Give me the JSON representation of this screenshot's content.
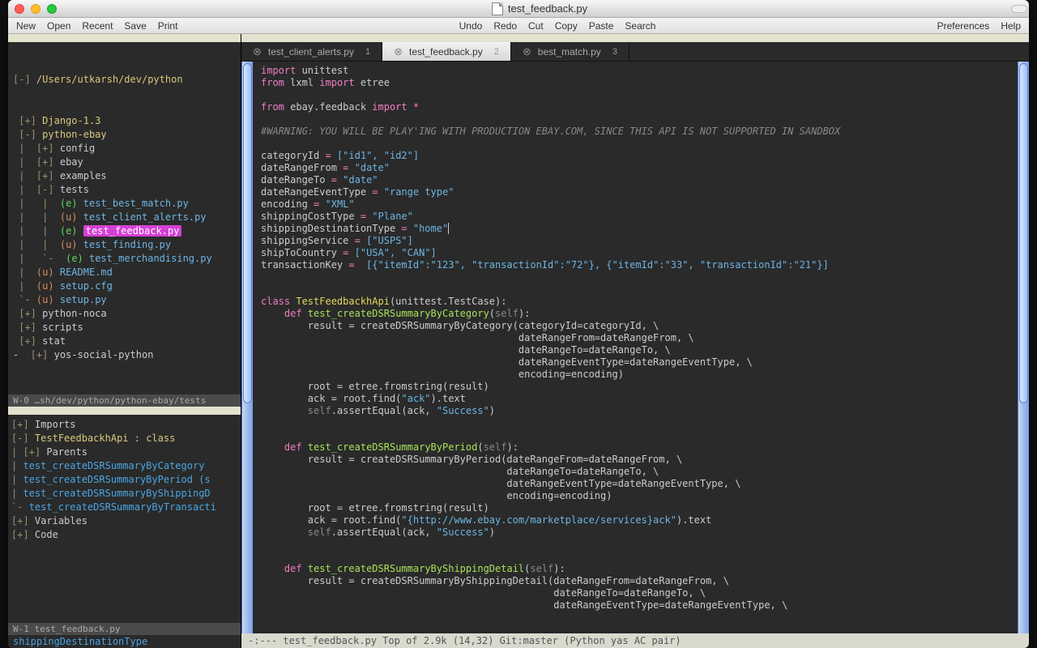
{
  "window": {
    "title": "test_feedback.py"
  },
  "menubar": {
    "left": [
      "New",
      "Open",
      "Recent",
      "Save",
      "Print"
    ],
    "center": [
      "Undo",
      "Redo",
      "Cut",
      "Copy",
      "Paste",
      "Search"
    ],
    "right": [
      "Preferences",
      "Help"
    ]
  },
  "sidebar": {
    "root": "/Users/utkarsh/dev/python",
    "tree": [
      {
        "indent": 0,
        "exp": "[+]",
        "name": "Django-1.3",
        "cls": "proj"
      },
      {
        "indent": 0,
        "exp": "[-]",
        "name": "python-ebay",
        "cls": "proj"
      },
      {
        "indent": 1,
        "exp": "[+]",
        "name": "config"
      },
      {
        "indent": 1,
        "exp": "[+]",
        "name": "ebay"
      },
      {
        "indent": 1,
        "exp": "[+]",
        "name": "examples"
      },
      {
        "indent": 1,
        "exp": "[-]",
        "name": "tests"
      },
      {
        "indent": 2,
        "status": "(e)",
        "name": "test_best_match.py",
        "cls": "file-py"
      },
      {
        "indent": 2,
        "status": "(u)",
        "name": "test_client_alerts.py",
        "cls": "file-py"
      },
      {
        "indent": 2,
        "status": "(e)",
        "name": "test_feedback.py",
        "cls": "file-py",
        "active": true
      },
      {
        "indent": 2,
        "status": "(u)",
        "name": "test_finding.py",
        "cls": "file-py"
      },
      {
        "indent": 2,
        "status": "(e)",
        "name": "test_merchandising.py",
        "cls": "file-py",
        "last": true
      },
      {
        "indent": 1,
        "status": "(u)",
        "name": "README.md",
        "cls": "file-md"
      },
      {
        "indent": 1,
        "status": "(u)",
        "name": "setup.cfg",
        "cls": "file-py"
      },
      {
        "indent": 1,
        "status": "(u)",
        "name": "setup.py",
        "cls": "file-py",
        "last": true
      },
      {
        "indent": 0,
        "exp": "[+]",
        "name": "python-noca"
      },
      {
        "indent": 0,
        "exp": "[+]",
        "name": "scripts"
      },
      {
        "indent": 0,
        "exp": "[+]",
        "name": "stat"
      },
      {
        "indent": 0,
        "exp": "[+]",
        "name": "yos-social-python",
        "pre": "- "
      }
    ],
    "w0": "W-0 …sh/dev/python/python-ebay/tests",
    "outline": [
      {
        "exp": "[+]",
        "label": "Imports"
      },
      {
        "exp": "[-]",
        "label": "TestFeedbackhApi : class",
        "cls": "cls"
      },
      {
        "exp": "|  [+]",
        "label": "Parents"
      },
      {
        "exp": "|  ",
        "label": "test_createDSRSummaryByCategory",
        "cls": "method"
      },
      {
        "exp": "|  ",
        "label": "test_createDSRSummaryByPeriod (s",
        "cls": "method"
      },
      {
        "exp": "|  ",
        "label": "test_createDSRSummaryByShippingD",
        "cls": "method"
      },
      {
        "exp": "`- ",
        "label": "test_createDSRSummaryByTransacti",
        "cls": "method"
      },
      {
        "exp": "[+]",
        "label": "Variables"
      },
      {
        "exp": "[+]",
        "label": "Code"
      }
    ],
    "w1": "W-1 test_feedback.py",
    "echo": "shippingDestinationType"
  },
  "tabs": [
    {
      "label": "test_client_alerts.py",
      "num": "1",
      "active": false
    },
    {
      "label": "test_feedback.py",
      "num": "2",
      "active": true
    },
    {
      "label": "best_match.py",
      "num": "3",
      "active": false
    }
  ],
  "code": {
    "l1": {
      "kw1": "import",
      "m1": "unittest"
    },
    "l2": {
      "kw1": "from",
      "m1": "lxml",
      "kw2": "import",
      "m2": "etree"
    },
    "l4": {
      "kw1": "from",
      "m1": "ebay.feedback",
      "kw2": "import",
      "star": "*"
    },
    "comment": "#WARNING: YOU WILL BE PLAY'ING WITH PRODUCTION EBAY.COM, SINCE THIS API IS NOT SUPPORTED IN SANDBOX",
    "v1": {
      "n": "categoryId",
      "v": "[\"id1\", \"id2\"]"
    },
    "v2": {
      "n": "dateRangeFrom",
      "v": "\"date\""
    },
    "v3": {
      "n": "dateRangeTo",
      "v": "\"date\""
    },
    "v4": {
      "n": "dateRangeEventType",
      "v": "\"range type\""
    },
    "v5": {
      "n": "encoding",
      "v": "\"XML\""
    },
    "v6": {
      "n": "shippingCostType",
      "v": "\"Plane\""
    },
    "v7": {
      "n": "shippingDestinationType",
      "v": "\"home\""
    },
    "v8": {
      "n": "shippingService",
      "v": "[\"USPS\"]"
    },
    "v9": {
      "n": "shipToCountry",
      "v": "[\"USA\", \"CAN\"]"
    },
    "v10": {
      "n": "transactionKey",
      "v": " [{\"itemId\":\"123\", \"transactionId\":\"72\"}, {\"itemId\":\"33\", \"transactionId\":\"21\"}]"
    },
    "cls": {
      "kw": "class",
      "name": "TestFeedbackhApi",
      "base": "(unittest.TestCase):"
    },
    "m1": {
      "kw": "def",
      "name": "test_createDSRSummaryByCategory",
      "sig": "(self):",
      "body1": "result = createDSRSummaryByCategory(categoryId=categoryId, \\",
      "body2": "                                    dateRangeFrom=dateRangeFrom, \\",
      "body3": "                                    dateRangeTo=dateRangeTo, \\",
      "body4": "                                    dateRangeEventType=dateRangeEventType, \\",
      "body5": "                                    encoding=encoding)",
      "body6": "root = etree.fromstring(result)",
      "body7a": "ack = root.find(",
      "str7": "\"ack\"",
      "body7b": ").text",
      "body8a": "self",
      "body8b": ".assertEqual(ack, ",
      "str8": "\"Success\"",
      "body8c": ")"
    },
    "m2": {
      "kw": "def",
      "name": "test_createDSRSummaryByPeriod",
      "sig": "(self):",
      "body1": "result = createDSRSummaryByPeriod(dateRangeFrom=dateRangeFrom, \\",
      "body2": "                                  dateRangeTo=dateRangeTo, \\",
      "body3": "                                  dateRangeEventType=dateRangeEventType, \\",
      "body4": "                                  encoding=encoding)",
      "body5": "root = etree.fromstring(result)",
      "body6a": "ack = root.find(",
      "str6": "\"{http://www.ebay.com/marketplace/services}ack\"",
      "body6b": ").text",
      "body7a": "self",
      "body7b": ".assertEqual(ack, ",
      "str7": "\"Success\"",
      "body7c": ")"
    },
    "m3": {
      "kw": "def",
      "name": "test_createDSRSummaryByShippingDetail",
      "sig": "(self):",
      "body1": "result = createDSRSummaryByShippingDetail(dateRangeFrom=dateRangeFrom, \\",
      "body2": "                                          dateRangeTo=dateRangeTo, \\",
      "body3": "                                          dateRangeEventType=dateRangeEventType, \\"
    }
  },
  "modeline": "-:---  test_feedback.py   Top of 2.9k (14,32)   Git:master  (Python yas AC pair)"
}
